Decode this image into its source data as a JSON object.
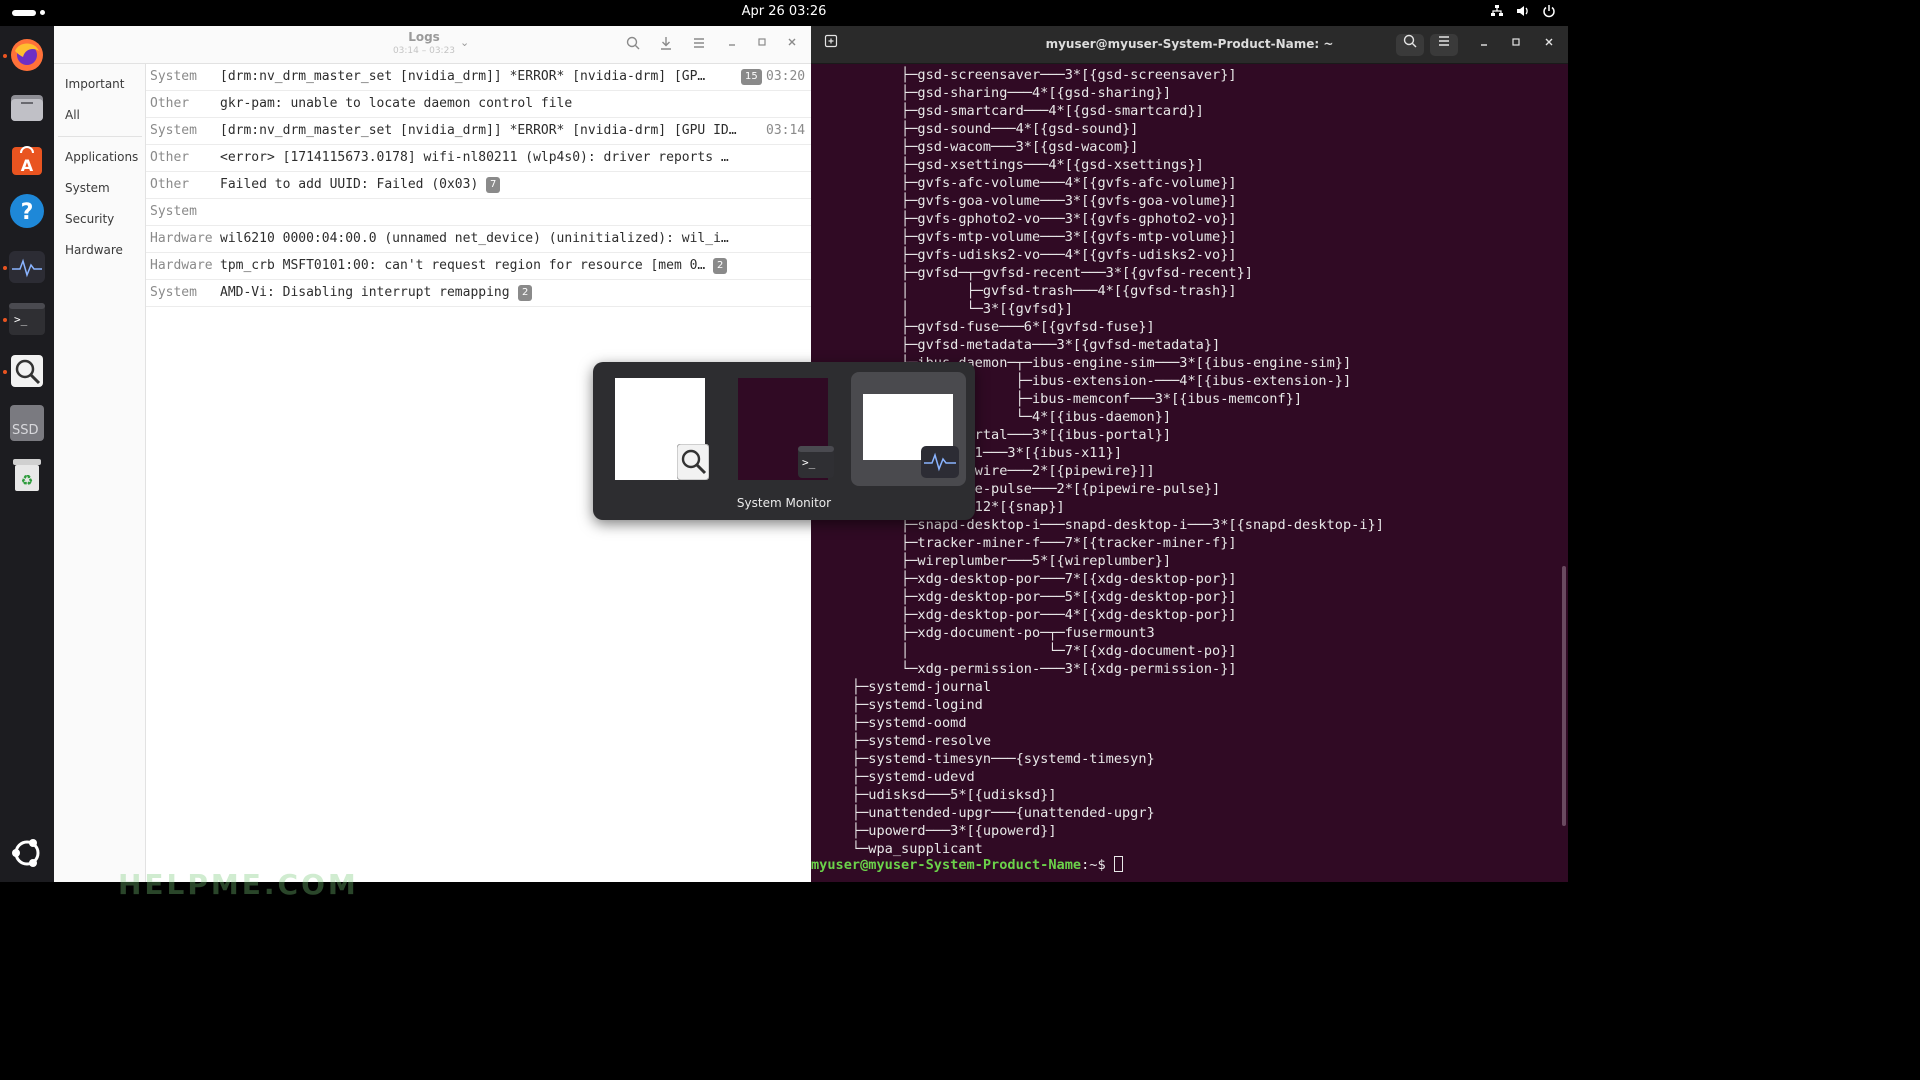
{
  "topbar": {
    "clock": "Apr 26  03:26"
  },
  "dock": {
    "items": [
      {
        "name": "firefox-icon",
        "running": true
      },
      {
        "name": "files-icon",
        "running": false
      },
      {
        "name": "app-center-icon",
        "running": false
      },
      {
        "name": "help-icon",
        "running": false
      },
      {
        "name": "system-monitor-icon",
        "running": true
      },
      {
        "name": "terminal-icon",
        "running": true
      },
      {
        "name": "logs-icon",
        "running": true
      },
      {
        "name": "ssd-drive-icon",
        "running": false
      },
      {
        "name": "trash-icon",
        "running": false
      }
    ],
    "ssd_label": "SSD"
  },
  "logs": {
    "title": "Logs",
    "subtitle": "03:14 – 03:23",
    "categories": {
      "important": "Important",
      "all": "All",
      "applications": "Applications",
      "system": "System",
      "security": "Security",
      "hardware": "Hardware"
    },
    "rows": [
      {
        "category": "System",
        "message": "[drm:nv_drm_master_set [nvidia_drm]] *ERROR* [nvidia-drm] [GP…",
        "count": "15",
        "time": "03:20"
      },
      {
        "category": "Other",
        "message": "gkr-pam: unable to locate daemon control file",
        "count": "",
        "time": ""
      },
      {
        "category": "System",
        "message": "[drm:nv_drm_master_set [nvidia_drm]] *ERROR* [nvidia-drm] [GPU ID…",
        "count": "",
        "time": "03:14"
      },
      {
        "category": "Other",
        "message": "<error> [1714115673.0178] wifi-nl80211 (wlp4s0): driver reports …",
        "count": "",
        "time": ""
      },
      {
        "category": "Other",
        "message": "Failed to add UUID: Failed (0x03)",
        "count": "7",
        "time": ""
      },
      {
        "category": "System",
        "message": "",
        "count": "",
        "time": ""
      },
      {
        "category": "Hardware",
        "message": "wil6210 0000:04:00.0 (unnamed net_device) (uninitialized): wil_i…",
        "count": "",
        "time": ""
      },
      {
        "category": "Hardware",
        "message": "tpm_crb MSFT0101:00: can't request region for resource [mem 0…",
        "count": "2",
        "time": ""
      },
      {
        "category": "System",
        "message": "AMD-Vi: Disabling interrupt remapping",
        "count": "2",
        "time": ""
      }
    ]
  },
  "watermark": "HELPME.COM",
  "terminal": {
    "title": "myuser@myuser-System-Product-Name: ~",
    "lines": [
      "           ├─gsd-screensaver───3*[{gsd-screensaver}]",
      "           ├─gsd-sharing───4*[{gsd-sharing}]",
      "           ├─gsd-smartcard───4*[{gsd-smartcard}]",
      "           ├─gsd-sound───4*[{gsd-sound}]",
      "           ├─gsd-wacom───3*[{gsd-wacom}]",
      "           ├─gsd-xsettings───4*[{gsd-xsettings}]",
      "           ├─gvfs-afc-volume───4*[{gvfs-afc-volume}]",
      "           ├─gvfs-goa-volume───3*[{gvfs-goa-volume}]",
      "           ├─gvfs-gphoto2-vo───3*[{gvfs-gphoto2-vo}]",
      "           ├─gvfs-mtp-volume───3*[{gvfs-mtp-volume}]",
      "           ├─gvfs-udisks2-vo───4*[{gvfs-udisks2-vo}]",
      "           ├─gvfsd─┬─gvfsd-recent───3*[{gvfsd-recent}]",
      "           │       ├─gvfsd-trash───4*[{gvfsd-trash}]",
      "           │       └─3*[{gvfsd}]",
      "           ├─gvfsd-fuse───6*[{gvfsd-fuse}]",
      "           ├─gvfsd-metadata───3*[{gvfsd-metadata}]",
      "           ├─ibus-daemon─┬─ibus-engine-sim───3*[{ibus-engine-sim}]",
      "           │             ├─ibus-extension-───4*[{ibus-extension-}]",
      "           │             ├─ibus-memconf───3*[{ibus-memconf}]",
      "           │             └─4*[{ibus-daemon}]",
      "           ├─ibus-portal───3*[{ibus-portal}]",
      "           ├─ibus-x11───3*[{ibus-x11}]",
      "           ├─2*[pipewire───2*[{pipewire}]]",
      "           ├─pipewire-pulse───2*[{pipewire-pulse}]",
      "           ├─snap───12*[{snap}]",
      "           ├─snapd-desktop-i───snapd-desktop-i───3*[{snapd-desktop-i}]",
      "           ├─tracker-miner-f───7*[{tracker-miner-f}]",
      "           ├─wireplumber───5*[{wireplumber}]",
      "           ├─xdg-desktop-por───7*[{xdg-desktop-por}]",
      "           ├─xdg-desktop-por───5*[{xdg-desktop-por}]",
      "           ├─xdg-desktop-por───4*[{xdg-desktop-por}]",
      "           ├─xdg-document-po─┬─fusermount3",
      "           │                 └─7*[{xdg-document-po}]",
      "           └─xdg-permission-───3*[{xdg-permission-}]",
      "     ├─systemd-journal",
      "     ├─systemd-logind",
      "     ├─systemd-oomd",
      "     ├─systemd-resolve",
      "     ├─systemd-timesyn───{systemd-timesyn}",
      "     ├─systemd-udevd",
      "     ├─udisksd───5*[{udisksd}]",
      "     ├─unattended-upgr───{unattended-upgr}",
      "     ├─upowerd───3*[{upowerd}]",
      "     └─wpa_supplicant"
    ],
    "prompt_user": "myuser@myuser-System-Product-Name",
    "prompt_suffix": ":~$ "
  },
  "switcher": {
    "selected_label": "System Monitor"
  },
  "colors": {
    "terminal_bg": "#300a24",
    "prompt_green": "#6bd24a",
    "ubuntu_orange": "#e95420"
  }
}
